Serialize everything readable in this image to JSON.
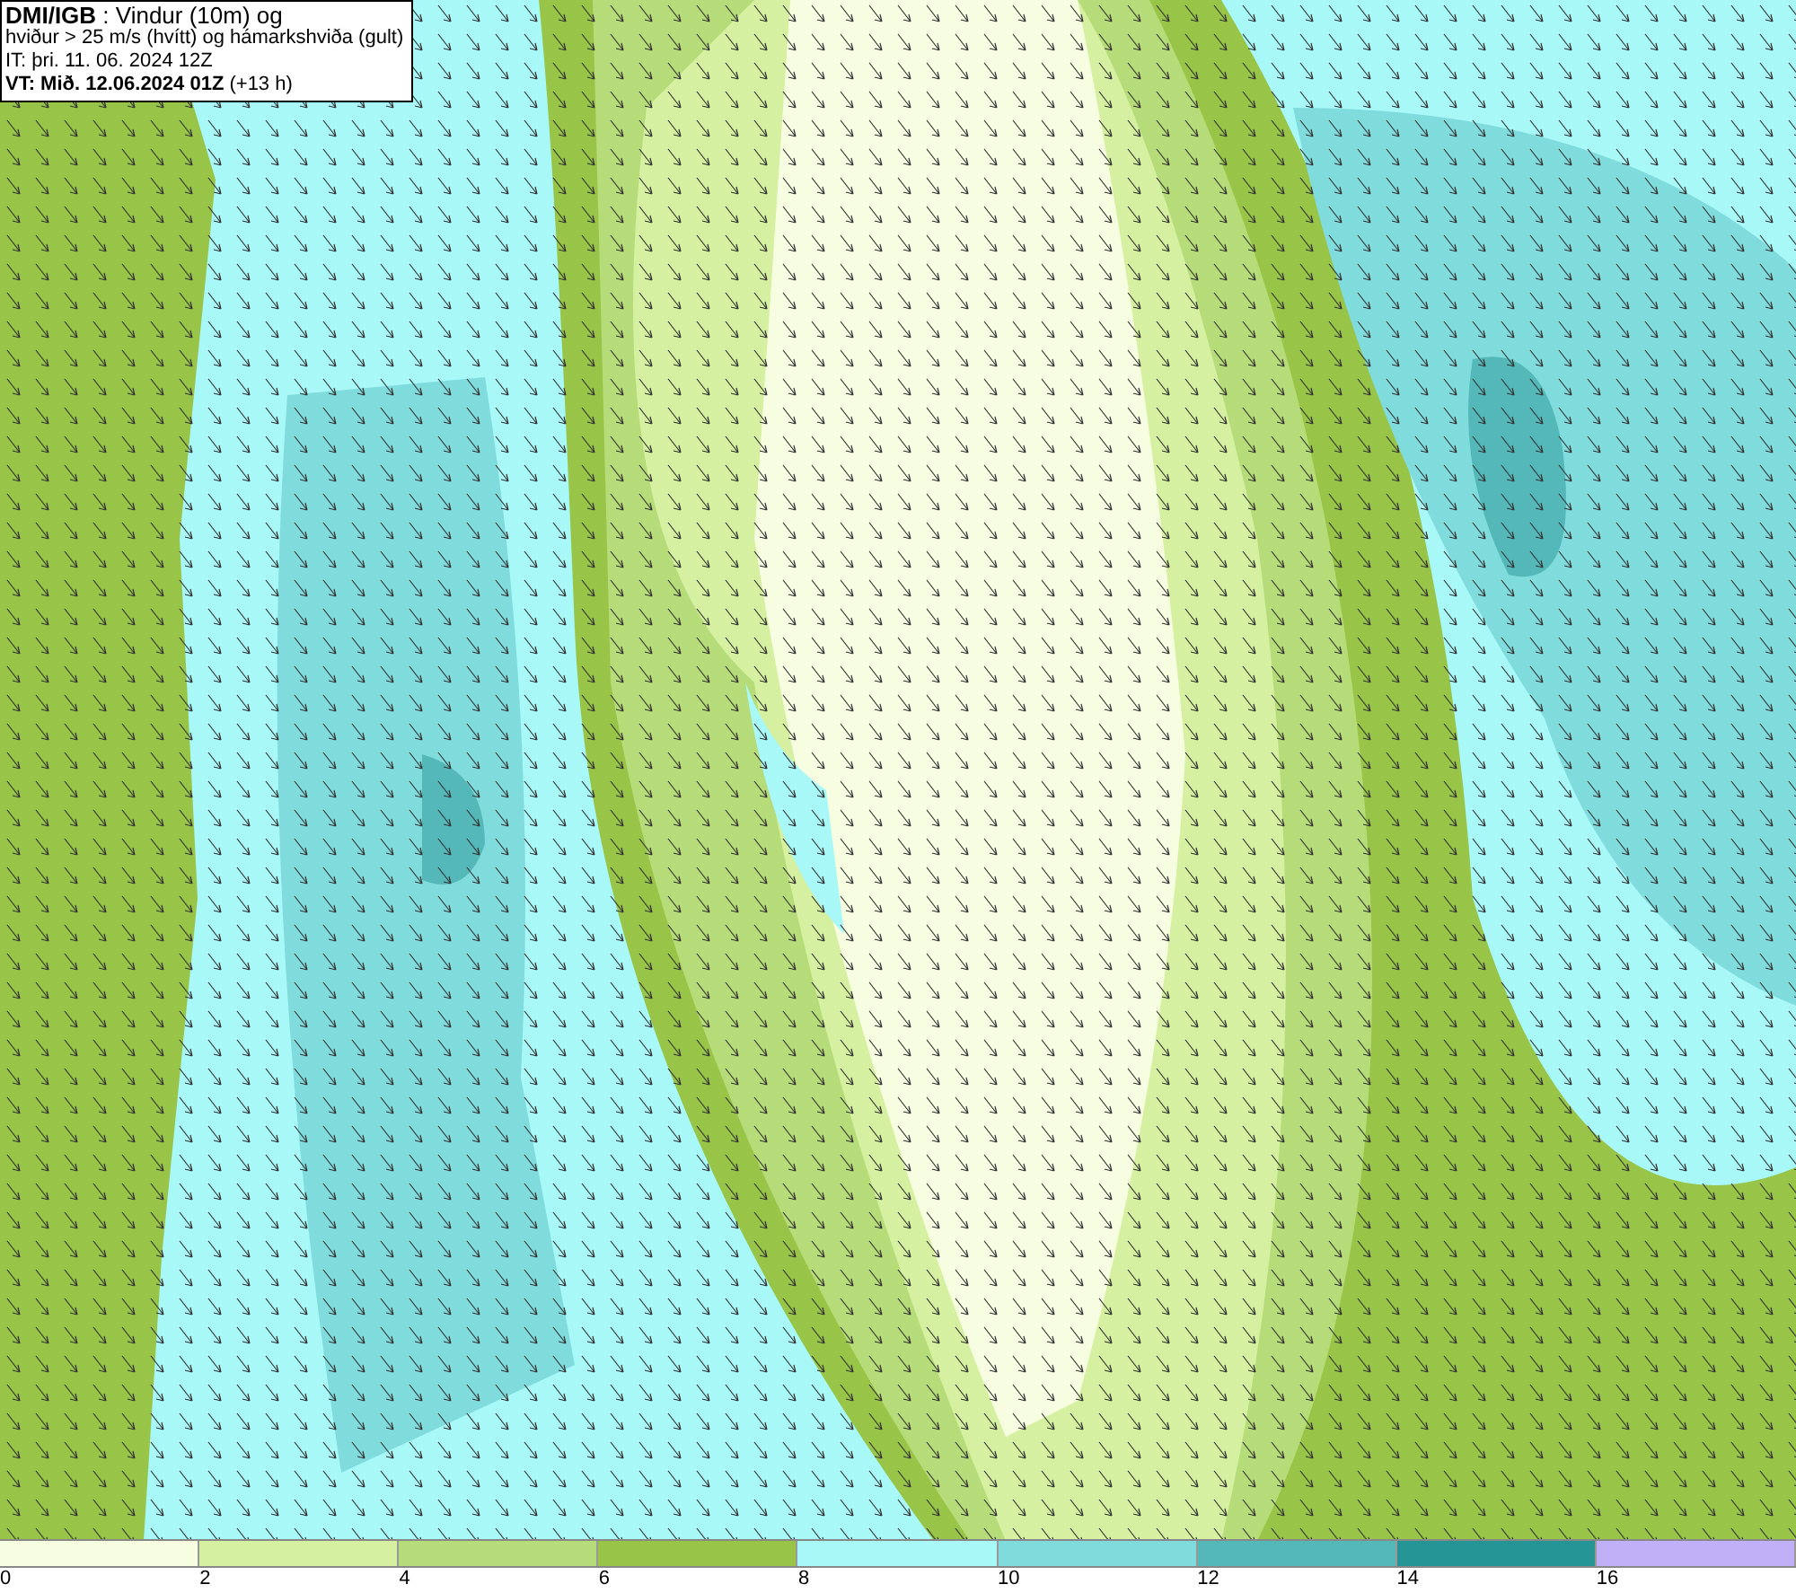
{
  "title_box": {
    "lines": [
      "**DMI/IGB** : Vindur (10m) og",
      "hviður > 25 m/s (hvítt) og hámarkshviða (gult)",
      "IT: þri. 11. 06. 2024 12Z",
      "**VT: Mið. 12.06.2024 01Z** (+13 h)"
    ]
  },
  "legend": {
    "segments": [
      {
        "color": "#f7fde0"
      },
      {
        "color": "#d5f0a0"
      },
      {
        "color": "#b5dc78"
      },
      {
        "color": "#98c448"
      },
      {
        "color": "#a8f8f8"
      },
      {
        "color": "#80dcdc"
      },
      {
        "color": "#55b8b8"
      },
      {
        "color": "#249494"
      },
      {
        "color": "#c0b0f8"
      }
    ],
    "ticks": [
      "0",
      "2",
      "4",
      "6",
      "8",
      "10",
      "12",
      "14",
      "16"
    ]
  }
}
